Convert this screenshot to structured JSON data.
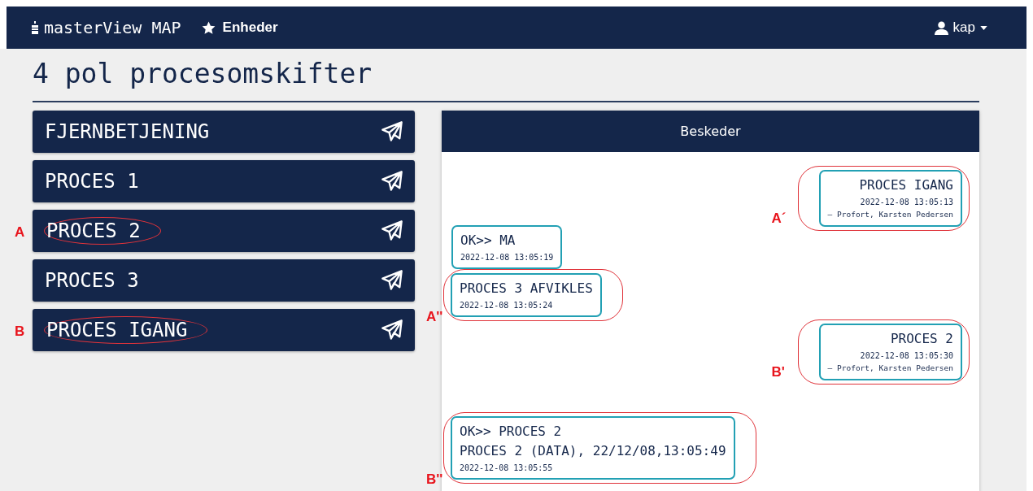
{
  "navbar": {
    "brand": "masterView MAP",
    "nav_link": "Enheder",
    "user": "kap"
  },
  "title": "4 pol procesomskifter",
  "commands": [
    {
      "label": "FJERNBETJENING"
    },
    {
      "label": "PROCES 1"
    },
    {
      "label": "PROCES 2",
      "annotation": "A"
    },
    {
      "label": "PROCES 3"
    },
    {
      "label": "PROCES IGANG",
      "annotation": "B"
    }
  ],
  "messages_panel": {
    "title": "Beskeder",
    "messages": [
      {
        "kind": "sent",
        "lines": [
          "PROCES IGANG"
        ],
        "time": "2022-12-08 13:05:13",
        "author": "– Profort, Karsten Pedersen",
        "annotation": "A´"
      },
      {
        "kind": "received",
        "lines": [
          "OK>> MA"
        ],
        "time": "2022-12-08 13:05:19"
      },
      {
        "kind": "received",
        "lines": [
          "PROCES 3 AFVIKLES"
        ],
        "time": "2022-12-08 13:05:24",
        "annotation": "A''"
      },
      {
        "kind": "sent",
        "lines": [
          "PROCES 2"
        ],
        "time": "2022-12-08 13:05:30",
        "author": "– Profort, Karsten Pedersen",
        "annotation": "B'"
      },
      {
        "kind": "received",
        "lines": [
          "OK>> PROCES 2",
          "PROCES 2 (DATA), 22/12/08,13:05:49"
        ],
        "time": "2022-12-08 13:05:55",
        "annotation": "B''"
      }
    ]
  }
}
